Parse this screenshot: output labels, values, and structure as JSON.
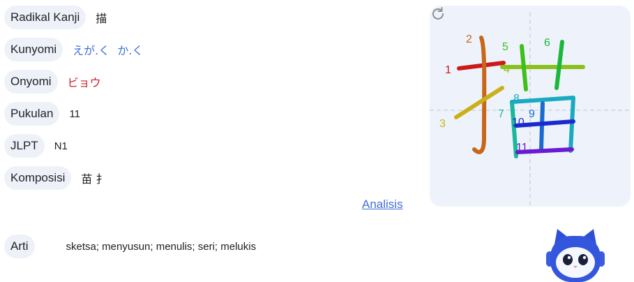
{
  "kanji_info": {
    "radical": {
      "label": "Radikal Kanji",
      "value": "描"
    },
    "kunyomi": {
      "label": "Kunyomi",
      "value": "えが.く か.く"
    },
    "onyomi": {
      "label": "Onyomi",
      "value": "ビョウ"
    },
    "strokes": {
      "label": "Pukulan",
      "value": "11"
    },
    "jlpt": {
      "label": "JLPT",
      "value": "N1"
    },
    "composition": {
      "label": "Komposisi",
      "value": "苗 扌"
    }
  },
  "analysis_link": "Analisis",
  "meaning": {
    "label": "Arti",
    "value": "sketsa; menyusun; menulis; seri; melukis"
  },
  "stroke_diagram": {
    "character": "描",
    "stroke_numbers": [
      "1",
      "2",
      "3",
      "4",
      "5",
      "6",
      "7",
      "8",
      "9",
      "10",
      "11"
    ],
    "replay_icon": "replay-icon"
  },
  "colors": {
    "pill_bg": "#eef2f8",
    "kunyomi": "#3f6fd8",
    "onyomi": "#c8232c",
    "link": "#3f6fd8",
    "panel_bg": "#eef3fb"
  },
  "mascot_icon": "robot-cat-mascot-icon"
}
